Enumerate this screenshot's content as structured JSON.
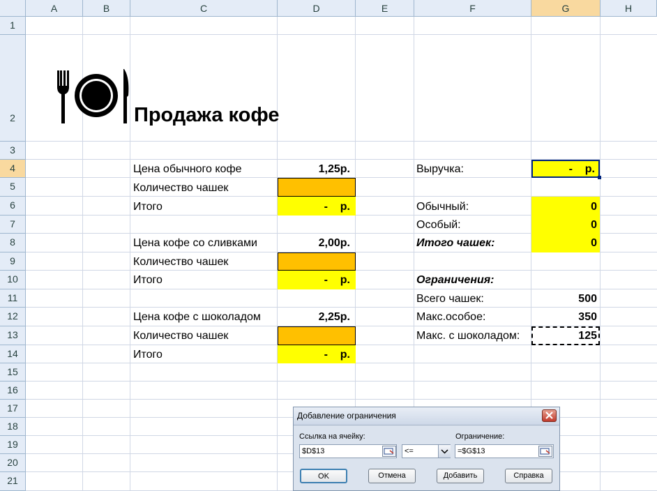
{
  "columns": [
    "A",
    "B",
    "C",
    "D",
    "E",
    "F",
    "G",
    "H"
  ],
  "rows": [
    "1",
    "2",
    "3",
    "4",
    "5",
    "6",
    "7",
    "8",
    "9",
    "10",
    "11",
    "12",
    "13",
    "14",
    "15",
    "16",
    "17",
    "18",
    "19",
    "20",
    "21"
  ],
  "title": "Продажа кофе",
  "left_table": {
    "row4_label": "Цена обычного кофе",
    "row4_value": "1,25р.",
    "row5_label": "Количество чашек",
    "row6_label": "Итого",
    "row6_value": "-    р.",
    "row8_label": "Цена кофе со сливками",
    "row8_value": "2,00р.",
    "row9_label": "Количество чашек",
    "row10_label": "Итого",
    "row10_value": "-    р.",
    "row12_label": "Цена кофе с шоколадом",
    "row12_value": "2,25р.",
    "row13_label": "Количество чашек",
    "row14_label": "Итого",
    "row14_value": "-    р."
  },
  "right_table": {
    "revenue_label": "Выручка:",
    "revenue_value": "-    р.",
    "regular_label": "Обычный:",
    "regular_value": "0",
    "special_label": "Особый:",
    "special_value": "0",
    "total_cups_label": "Итого чашек:",
    "total_cups_value": "0",
    "constraints_label": "Ограничения:",
    "all_cups_label": "Всего чашек:",
    "all_cups_value": "500",
    "max_special_label": "Макс.особое:",
    "max_special_value": "350",
    "max_choc_label": "Макс. с шоколадом:",
    "max_choc_value": "125"
  },
  "dialog": {
    "title": "Добавление ограничения",
    "cell_ref_label": "Ссылка на ячейку:",
    "cell_ref_value": "$D$13",
    "operator_value": "<=",
    "constraint_label": "Ограничение:",
    "constraint_value": "=$G$13",
    "ok_label": "OK",
    "cancel_label": "Отмена",
    "add_label": "Добавить",
    "help_label": "Справка"
  },
  "colors": {
    "yellow": "#ffff00",
    "orange": "#ffc000",
    "header_bg": "#e4ecf7",
    "header_selected": "#f9d99f",
    "active_border": "#00247d"
  }
}
